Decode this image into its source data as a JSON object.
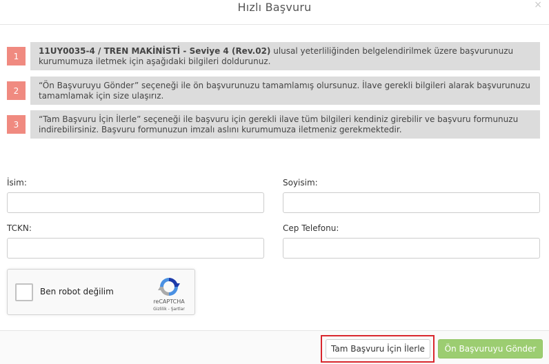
{
  "modal": {
    "title": "Hızlı Başvuru",
    "close_symbol": "×"
  },
  "steps": [
    {
      "number": "1",
      "bold_text": "11UY0035-4 / TREN MAKİNİSTİ - Seviye 4 (Rev.02)",
      "text": " ulusal yeterliliğinden belgelendirilmek üzere başvurunuzu kurumumuza iletmek için aşağıdaki bilgileri doldurunuz."
    },
    {
      "number": "2",
      "text": "“Ön Başvuruyu Gönder” seçeneği ile ön başvurunuzu tamamlamış olursunuz. İlave gerekli bilgileri alarak başvurunuzu tamamlamak için size ulaşırız."
    },
    {
      "number": "3",
      "text": "“Tam Başvuru İçin İlerle” seçeneği ile başvuru için gerekli ilave tüm bilgileri kendiniz girebilir ve başvuru formunuzu indirebilirsiniz. Başvuru formunuzun imzalı aslını kurumumuza iletmeniz gerekmektedir."
    }
  ],
  "form": {
    "name_label": "İsim:",
    "name_value": "",
    "surname_label": "Soyisim:",
    "surname_value": "",
    "tckn_label": "TCKN:",
    "tckn_value": "",
    "phone_label": "Cep Telefonu:",
    "phone_value": ""
  },
  "recaptcha": {
    "label": "Ben robot değilim",
    "brand": "reCAPTCHA",
    "terms": "Gizlilik - Şartlar",
    "checked": false
  },
  "footer": {
    "full_apply_label": "Tam Başvuru İçin İlerle",
    "pre_apply_label": "Ön Başvuruyu Gönder"
  },
  "colors": {
    "step_number_bg": "#f08a80",
    "step_box_bg": "#dcdcdc",
    "success_button": "#9ccd71",
    "highlight_border": "#d9262c"
  }
}
